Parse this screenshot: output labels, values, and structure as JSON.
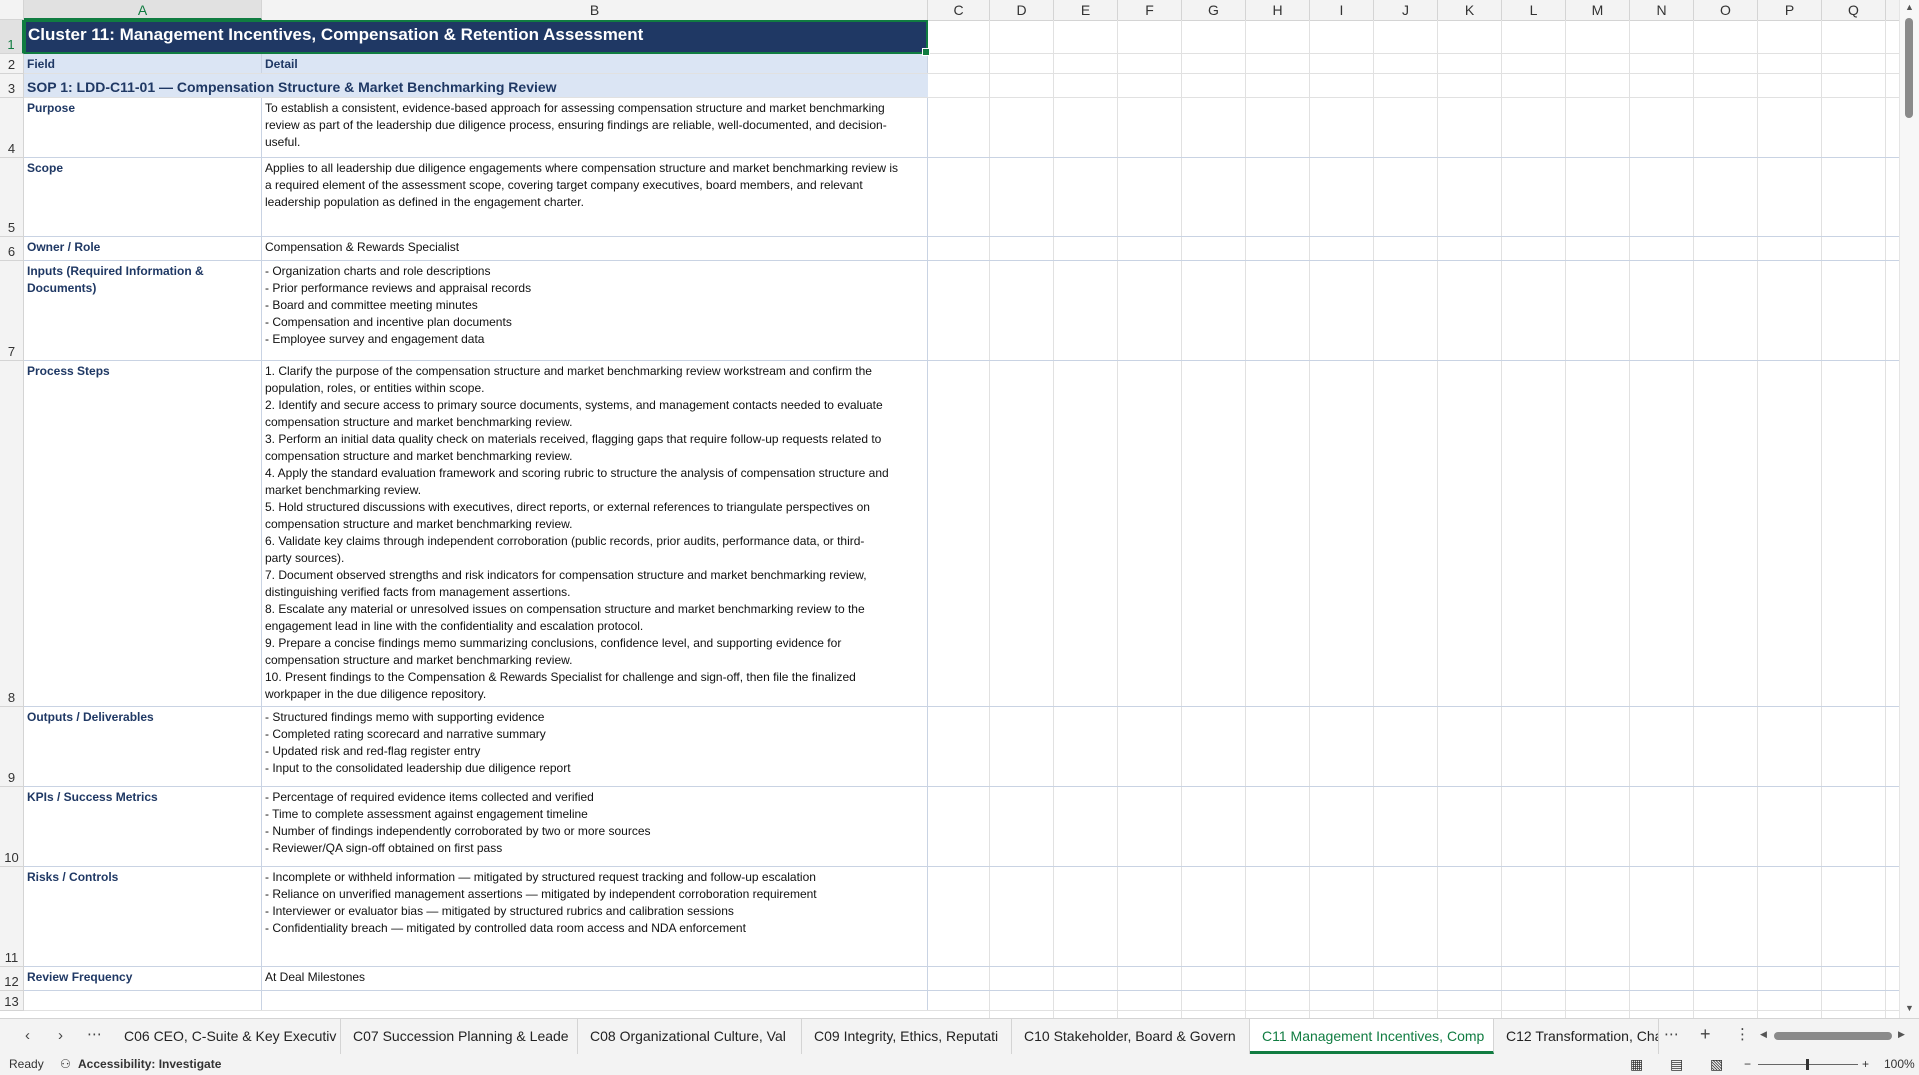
{
  "columns": [
    "A",
    "B",
    "C",
    "D",
    "E",
    "F",
    "G",
    "H",
    "I",
    "J",
    "K",
    "L",
    "M",
    "N",
    "O",
    "P",
    "Q"
  ],
  "rows": [
    {
      "num": "1",
      "kind": "title",
      "a": "Cluster 11: Management Incentives, Compensation & Retention Assessment",
      "b": ""
    },
    {
      "num": "2",
      "kind": "hdr",
      "a": "Field",
      "b": "Detail"
    },
    {
      "num": "3",
      "kind": "sop",
      "a": "SOP 1: LDD-C11-01 — Compensation Structure & Market Benchmarking Review",
      "b": ""
    },
    {
      "num": "4",
      "kind": "field",
      "a": "Purpose",
      "b": "To establish a consistent, evidence-based approach for assessing compensation structure and market benchmarking\nreview as part of the leadership due diligence process, ensuring findings are reliable, well-documented, and decision-\nuseful."
    },
    {
      "num": "5",
      "kind": "field",
      "a": "Scope",
      "b": "Applies to all leadership due diligence engagements where compensation structure and market benchmarking review is\na required element of the assessment scope, covering target company executives, board members, and relevant\nleadership population as defined in the engagement charter."
    },
    {
      "num": "6",
      "kind": "field",
      "a": "Owner / Role",
      "b": "Compensation & Rewards Specialist"
    },
    {
      "num": "7",
      "kind": "field",
      "a": "Inputs (Required Information & Documents)",
      "b": "- Organization charts and role descriptions\n- Prior performance reviews and appraisal records\n- Board and committee meeting minutes\n- Compensation and incentive plan documents\n- Employee survey and engagement data"
    },
    {
      "num": "8",
      "kind": "field",
      "a": "Process Steps",
      "b": "1. Clarify the purpose of the compensation structure and market benchmarking review workstream and confirm the\npopulation, roles, or entities within scope.\n2. Identify and secure access to primary source documents, systems, and management contacts needed to evaluate\ncompensation structure and market benchmarking review.\n3. Perform an initial data quality check on materials received, flagging gaps that require follow-up requests related to\ncompensation structure and market benchmarking review.\n4. Apply the standard evaluation framework and scoring rubric to structure the analysis of compensation structure and\nmarket benchmarking review.\n5. Hold structured discussions with executives, direct reports, or external references to triangulate perspectives on\ncompensation structure and market benchmarking review.\n6. Validate key claims through independent corroboration (public records, prior audits, performance data, or third-\nparty sources).\n7. Document observed strengths and risk indicators for compensation structure and market benchmarking review,\ndistinguishing verified facts from management assertions.\n8. Escalate any material or unresolved issues on compensation structure and market benchmarking review to the\nengagement lead in line with the confidentiality and escalation protocol.\n9. Prepare a concise findings memo summarizing conclusions, confidence level, and supporting evidence for\ncompensation structure and market benchmarking review.\n10. Present findings to the Compensation & Rewards Specialist for challenge and sign-off, then file the finalized\nworkpaper in the due diligence repository."
    },
    {
      "num": "9",
      "kind": "field",
      "a": "Outputs / Deliverables",
      "b": "- Structured findings memo with supporting evidence\n- Completed rating scorecard and narrative summary\n- Updated risk and red-flag register entry\n- Input to the consolidated leadership due diligence report"
    },
    {
      "num": "10",
      "kind": "field",
      "a": "KPIs / Success Metrics",
      "b": "- Percentage of required evidence items collected and verified\n- Time to complete assessment against engagement timeline\n- Number of findings independently corroborated by two or more sources\n- Reviewer/QA sign-off obtained on first pass"
    },
    {
      "num": "11",
      "kind": "field",
      "a": "Risks / Controls",
      "b": "- Incomplete or withheld information — mitigated by structured request tracking and follow-up escalation\n- Reliance on unverified management assertions — mitigated by independent corroboration requirement\n- Interviewer or evaluator bias — mitigated by structured rubrics and calibration sessions\n- Confidentiality breach — mitigated by controlled data room access and NDA enforcement"
    },
    {
      "num": "12",
      "kind": "field",
      "a": "Review Frequency",
      "b": "At Deal Milestones"
    },
    {
      "num": "13",
      "kind": "empty",
      "a": "",
      "b": ""
    }
  ],
  "tabs": [
    {
      "label": "C06 CEO, C-Suite & Key Executiv",
      "active": false
    },
    {
      "label": "C07 Succession Planning & Leade",
      "active": false
    },
    {
      "label": "C08 Organizational Culture, Val",
      "active": false
    },
    {
      "label": "C09 Integrity, Ethics, Reputati",
      "active": false
    },
    {
      "label": "C10 Stakeholder, Board & Govern",
      "active": false
    },
    {
      "label": "C11 Management Incentives, Comp",
      "active": true
    },
    {
      "label": "C12 Transformation, Cha",
      "active": false
    }
  ],
  "status": {
    "ready": "Ready",
    "accessibility": "Accessibility: Investigate",
    "zoom": "100%"
  },
  "icons": {
    "prev": "chevron-left-icon",
    "next": "chevron-right-icon",
    "more": "ellipsis-icon",
    "add": "plus-icon"
  }
}
